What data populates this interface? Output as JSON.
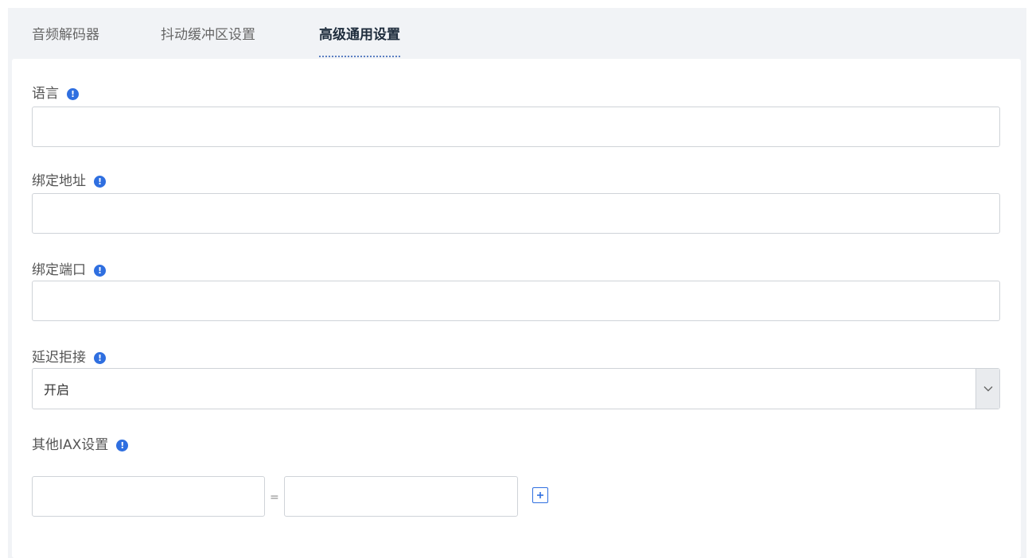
{
  "tabs": [
    {
      "label": "音频解码器",
      "active": false
    },
    {
      "label": "抖动缓冲区设置",
      "active": false
    },
    {
      "label": "高级通用设置",
      "active": true
    }
  ],
  "fields": {
    "language": {
      "label": "语言",
      "value": ""
    },
    "bind_address": {
      "label": "绑定地址",
      "value": ""
    },
    "bind_port": {
      "label": "绑定端口",
      "value": ""
    },
    "delay_reject": {
      "label": "延迟拒接",
      "selected": "开启"
    },
    "other_iax": {
      "label": "其他IAX设置",
      "key": "",
      "value": "",
      "separator": "="
    }
  },
  "icons": {
    "info": "info-icon",
    "select_arrow": "chevron-down-icon",
    "add": "plus-square-icon"
  },
  "colors": {
    "accent": "#2f6fe0",
    "tab_underline": "#5b7fc2",
    "background": "#f1f3f6"
  }
}
